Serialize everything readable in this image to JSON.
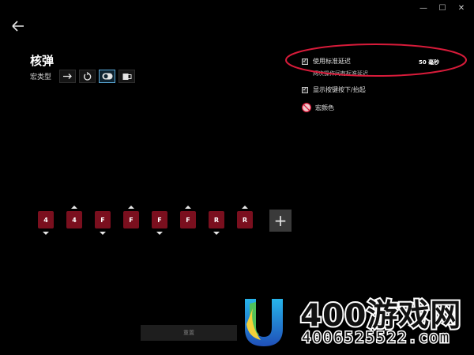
{
  "window": {
    "minimize": "—",
    "maximize": "☐",
    "close": "✕"
  },
  "page": {
    "title": "核弹",
    "macro_type_label": "宏类型"
  },
  "macro_types": [
    "no-repeat-icon",
    "repeat-while-held-icon",
    "toggle-icon",
    "sequence-icon"
  ],
  "options": {
    "use_standard_delay": "使用标准延迟",
    "delay_value": "50 毫秒",
    "delay_note": "两次操作间有标准延迟",
    "show_key_up_down": "显示按键按下/抬起",
    "macro_color": "宏颜色"
  },
  "sequence": [
    {
      "key": "4",
      "dir": "down"
    },
    {
      "key": "4",
      "dir": "up"
    },
    {
      "key": "F",
      "dir": "down"
    },
    {
      "key": "F",
      "dir": "up"
    },
    {
      "key": "F",
      "dir": "down"
    },
    {
      "key": "F",
      "dir": "up"
    },
    {
      "key": "R",
      "dir": "down"
    },
    {
      "key": "R",
      "dir": "up"
    }
  ],
  "add_label": "+",
  "reset_label": "重置",
  "watermark": {
    "title": "400游戏网",
    "sub": "4006525522.com"
  },
  "colors": {
    "key_bg": "#7a0f1e",
    "annotation": "#d81b3a",
    "selected": "#5aa7d6"
  }
}
